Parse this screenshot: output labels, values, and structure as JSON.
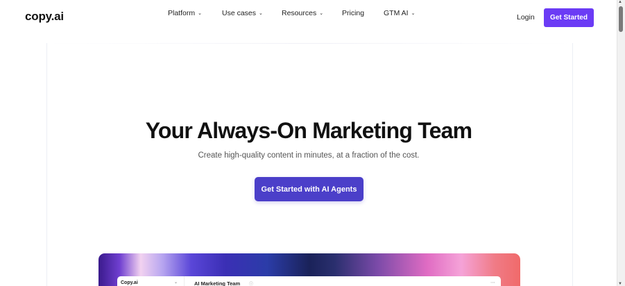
{
  "brand": {
    "logo": "copy.ai"
  },
  "nav": {
    "items": [
      {
        "label": "Platform",
        "has_dropdown": true
      },
      {
        "label": "Use cases",
        "has_dropdown": true
      },
      {
        "label": "Resources",
        "has_dropdown": true
      },
      {
        "label": "Pricing",
        "has_dropdown": false
      },
      {
        "label": "GTM AI",
        "has_dropdown": true
      }
    ],
    "login_label": "Login",
    "cta_label": "Get Started",
    "chevron_icon": "chevron-down-icon"
  },
  "hero": {
    "title": "Your Always-On Marketing Team",
    "subtitle": "Create high-quality content in minutes, at a fraction of the cost.",
    "cta_label": "Get Started with AI Agents"
  },
  "preview": {
    "brand": "Copy.ai",
    "title": "AI Marketing Team",
    "info_icon": "info-icon",
    "more_icon": "more-icon"
  },
  "colors": {
    "nav_cta": "#6b3bf5",
    "hero_cta": "#4b3fc9",
    "text": "#111111",
    "subtitle": "#555555"
  }
}
